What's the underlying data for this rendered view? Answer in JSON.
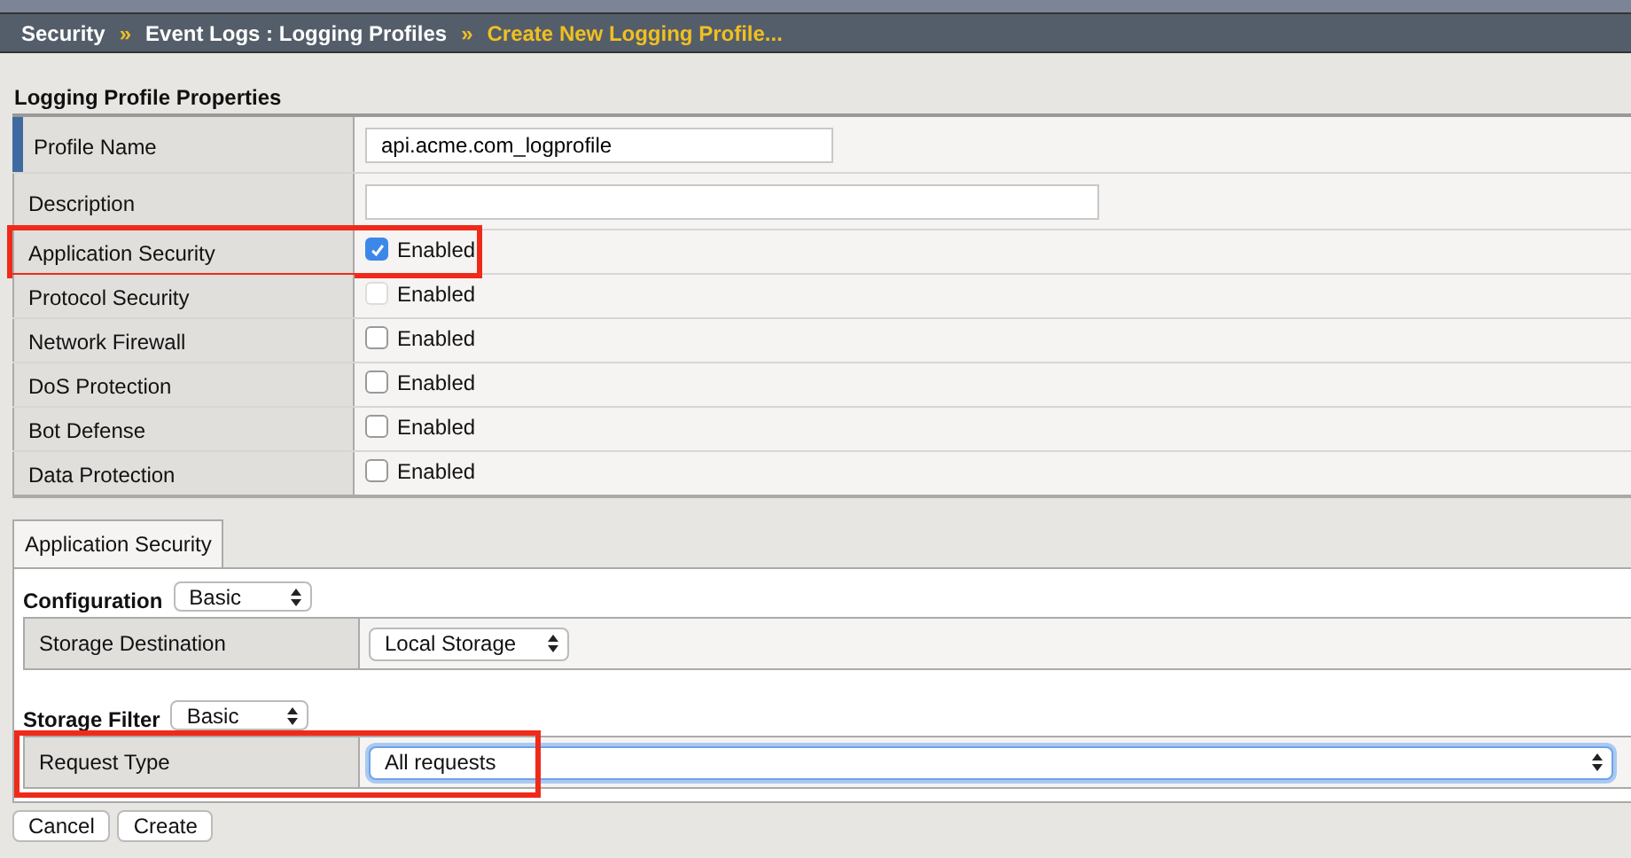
{
  "breadcrumb": [
    {
      "label": "Security",
      "current": false
    },
    {
      "label": "Event Logs : Logging Profiles",
      "current": false
    },
    {
      "label": "Create New Logging Profile...",
      "current": true
    }
  ],
  "breadcrumb_separator": "»",
  "properties": {
    "title": "Logging Profile Properties",
    "rows": [
      {
        "kind": "text",
        "label": "Profile Name",
        "value": "api.acme.com_logprofile",
        "required": true,
        "highlighted": false
      },
      {
        "kind": "text",
        "label": "Description",
        "required": false,
        "highlighted": false
      },
      {
        "kind": "checkbox",
        "label": "Application Security",
        "option": "Enabled",
        "checked": true,
        "disabled": false,
        "required": false,
        "highlighted": true
      },
      {
        "kind": "checkbox",
        "label": "Protocol Security",
        "option": "Enabled",
        "checked": false,
        "disabled": true,
        "required": false,
        "highlighted": false
      },
      {
        "kind": "checkbox",
        "label": "Network Firewall",
        "option": "Enabled",
        "checked": false,
        "disabled": false,
        "required": false,
        "highlighted": false
      },
      {
        "kind": "checkbox",
        "label": "DoS Protection",
        "option": "Enabled",
        "checked": false,
        "disabled": false,
        "required": false,
        "highlighted": false
      },
      {
        "kind": "checkbox",
        "label": "Bot Defense",
        "option": "Enabled",
        "checked": false,
        "disabled": false,
        "required": false,
        "highlighted": false
      },
      {
        "kind": "checkbox",
        "label": "Data Protection",
        "option": "Enabled",
        "checked": false,
        "disabled": false,
        "required": false,
        "highlighted": false
      }
    ]
  },
  "tabs": [
    {
      "label": "Application Security",
      "selected": true
    }
  ],
  "sections": [
    {
      "title": "Configuration",
      "mode": "Basic",
      "rows": [
        {
          "label": "Storage Destination",
          "value": "Local Storage",
          "wide": false,
          "focused": false,
          "highlighted": false
        }
      ]
    },
    {
      "title": "Storage Filter",
      "mode": "Basic",
      "rows": [
        {
          "label": "Request Type",
          "value": "All requests",
          "wide": true,
          "focused": true,
          "highlighted": true
        }
      ]
    }
  ],
  "buttons": [
    "Cancel",
    "Create"
  ]
}
